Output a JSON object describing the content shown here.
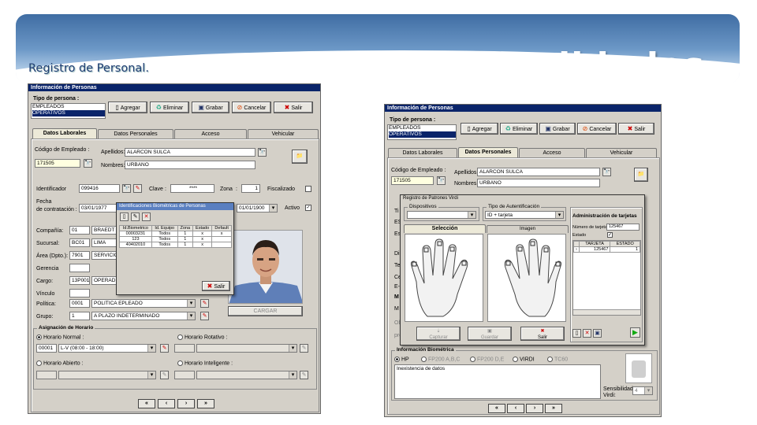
{
  "slide": {
    "title": "Funcionalidades",
    "subtitle": "Registro de Personal."
  },
  "left": {
    "window_title": "Información de Personas",
    "tipo_label": "Tipo de persona :",
    "tipos": [
      "EMPLEADOS",
      "OPERATIVOS"
    ],
    "toolbar": {
      "agregar": "Agregar",
      "eliminar": "Eliminar",
      "grabar": "Grabar",
      "cancelar": "Cancelar",
      "salir": "Salir"
    },
    "tabs": [
      "Datos Laborales",
      "Datos Personales",
      "Acceso",
      "Vehicular"
    ],
    "codigo_label": "Código de Empleado :",
    "codigo": "171505",
    "apellidos_label": "Apellidos:",
    "apellidos": "ALARCON SULCA",
    "nombres_label": "Nombres:",
    "nombres": "URBANO",
    "identificador_label": "Identificador",
    "identificador": "099416",
    "clave_label": "Clave",
    "clave": "****",
    "zona_label": "Zona",
    "zona": "1",
    "fiscalizado_label": "Fiscalizado",
    "fecha_label1": "Fecha",
    "fecha_label2": "de contratación :",
    "fecha": "03/01/1977",
    "fecha2": "01/01/1900",
    "activo_label": "Activo",
    "activo_check": "✓",
    "compania_label": "Compañía:",
    "compania_code": "01",
    "compania": "BRAEDT",
    "sucursal_label": "Sucursal:",
    "sucursal_code": "BC01",
    "sucursal": "LIMA",
    "area_label": "Área (Dpto.):",
    "area_code": "7901",
    "area": "SERVICIO",
    "gerencia_label": "Gerencia",
    "cargo_label": "Cargo:",
    "cargo_code": "13P001",
    "cargo": "OPERAD",
    "vinculo_label": "Vínculo",
    "politica_label": "Política:",
    "politica_code": "0001",
    "politica": "POLITICA EPLEADO",
    "grupo_label": "Grupo:",
    "grupo_code": "1",
    "grupo": "A PLAZO INDETERMINADO",
    "cargar": "CARGAR",
    "horario_title": "Asignación de Horario",
    "horario_normal": "Horario Normal :",
    "horario_rotativo": "Horario Rotativo :",
    "horario_code": "00001",
    "horario": "L-V (08:00 - 18:00)",
    "horario_abierto": "Horario Abierto :",
    "horario_inteligente": "Horario Inteligente :",
    "nav": [
      "«",
      "‹",
      "›",
      "»"
    ],
    "popup": {
      "title": "Identificaciones Biométricas de Personas",
      "headers": [
        "Id.Biometrico",
        "Id. Equipo",
        "Zona",
        "Estado",
        "Default"
      ],
      "rows": [
        [
          "00003231",
          "Todos",
          "1",
          "x",
          "x"
        ],
        [
          "123",
          "Todos",
          "1",
          "x",
          ""
        ],
        [
          "40402010",
          "Todos",
          "1",
          "x",
          ""
        ]
      ],
      "salir": "Salir"
    }
  },
  "right": {
    "window_title": "Información de Personas",
    "tipo_label": "Tipo de persona :",
    "tipos": [
      "EMPLEADOS",
      "OPERATIVOS"
    ],
    "toolbar": {
      "agregar": "Agregar",
      "eliminar": "Eliminar",
      "grabar": "Grabar",
      "cancelar": "Cancelar",
      "salir": "Salir"
    },
    "tabs": [
      "Datos Laborales",
      "Datos Personales",
      "Acceso",
      "Vehicular"
    ],
    "codigo_label": "Código de Empleado :",
    "codigo": "171505",
    "apellidos_label": "Apellidos:",
    "apellidos": "ALARCON SULCA",
    "nombres_label": "Nombres:",
    "nombres": "URBANO",
    "side_labels": [
      "Ti",
      "ES",
      "Es",
      "Dir",
      "Te",
      "Ce",
      "E-",
      "M",
      "M",
      "Ob",
      "pro"
    ],
    "dialog": {
      "title": "Registro de Patrones Virdi",
      "dispositivos_label": "Dispositivos",
      "tipo_aut_label": "Tipo de Autentificación",
      "tipo_aut": "ID + tarjeta",
      "seleccion": "Selección",
      "imagen": "Imagen",
      "capturar": "Capturar",
      "guardar": "Guardar",
      "salir": "Salir",
      "admin_title": "Administración de tarjetas",
      "num_tarjeta_label": "Número de tarjeta",
      "num_tarjeta": "125467",
      "estado_label": "Estado",
      "headers": [
        "TARJETA",
        "ESTADO"
      ],
      "row": [
        "125467",
        "1"
      ]
    },
    "bio_title": "Información Biométrica",
    "bio_options": [
      "HP",
      "FP200 A,B,C",
      "FP200 D,E",
      "VIRDI",
      "TC60"
    ],
    "bio_text": "Inexistencia de datos",
    "sensibilidad_label1": "Sensibilidad",
    "sensibilidad_label2": "Virdi:",
    "sensibilidad": "4",
    "nav": [
      "«",
      "‹",
      "›",
      "»"
    ]
  }
}
